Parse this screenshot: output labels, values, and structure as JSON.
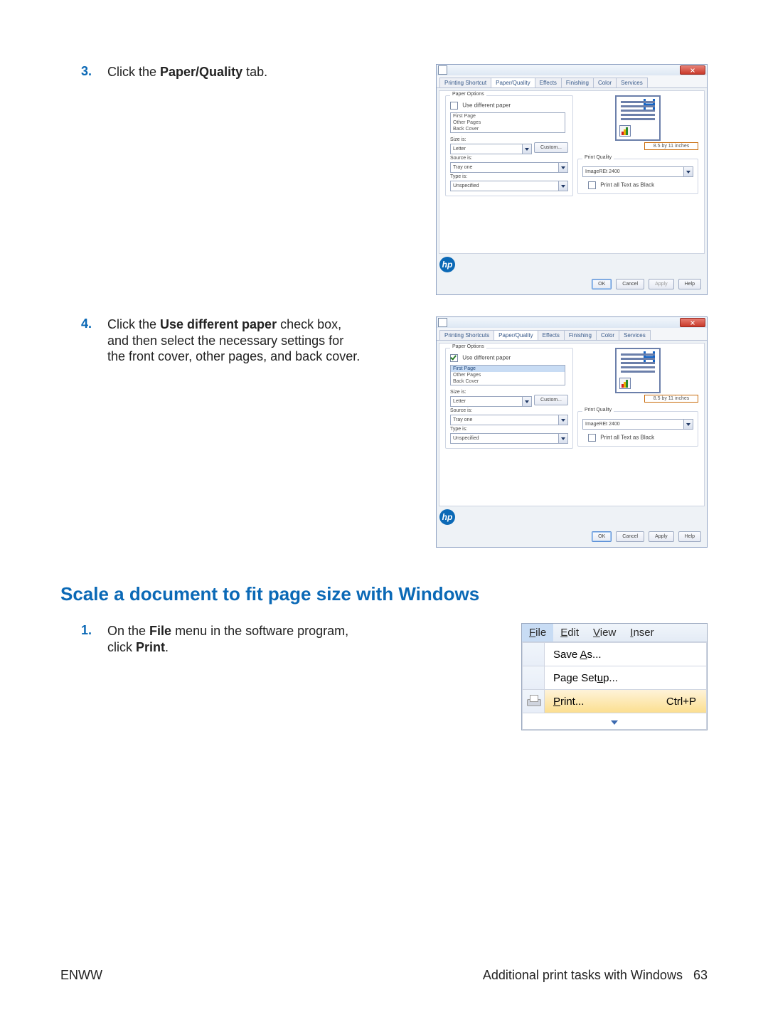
{
  "steps": {
    "s3": {
      "num": "3.",
      "pre": "Click the ",
      "bold": "Paper/Quality",
      "post": " tab."
    },
    "s4": {
      "num": "4.",
      "t_a": "Click the ",
      "t_b": "Use different paper",
      "t_c": " check box, and then select the necessary settings for the front cover, other pages, and back cover."
    },
    "s1": {
      "num": "1.",
      "a": "On the ",
      "b": "File",
      "c": " menu in the software program, click ",
      "d": "Print",
      "e": "."
    }
  },
  "heading": "Scale a document to fit page size with Windows",
  "dlg": {
    "tabs": [
      "Printing Shortcut",
      "Paper/Quality",
      "Effects",
      "Finishing",
      "Color",
      "Services"
    ],
    "tabs2": [
      "Printing Shortcuts",
      "Paper/Quality",
      "Effects",
      "Finishing",
      "Color",
      "Services"
    ],
    "paper_options": "Paper Options",
    "use_diff": "Use different paper",
    "list": [
      "First Page",
      "Other Pages",
      "Back Cover"
    ],
    "size_is": "Size is:",
    "size_val": "Letter",
    "custom": "Custom...",
    "source_is": "Source is:",
    "source_val": "Tray one",
    "type_is": "Type is:",
    "type_val": "Unspecified",
    "dims": "8.5 by 11 inches",
    "pq": "Print Quality",
    "pq_val": "ImageREt 2400",
    "black": "Print all Text as Black",
    "ok": "OK",
    "cancel": "Cancel",
    "apply": "Apply",
    "help": "Help"
  },
  "menu": {
    "file": "File",
    "edit": "Edit",
    "view": "View",
    "inser": "Inser",
    "save": "Save As...",
    "page": "Page Setup...",
    "print": "Print...",
    "ctrlp": "Ctrl+P"
  },
  "footer": {
    "left": "ENWW",
    "right": "Additional print tasks with Windows",
    "page": "63"
  }
}
